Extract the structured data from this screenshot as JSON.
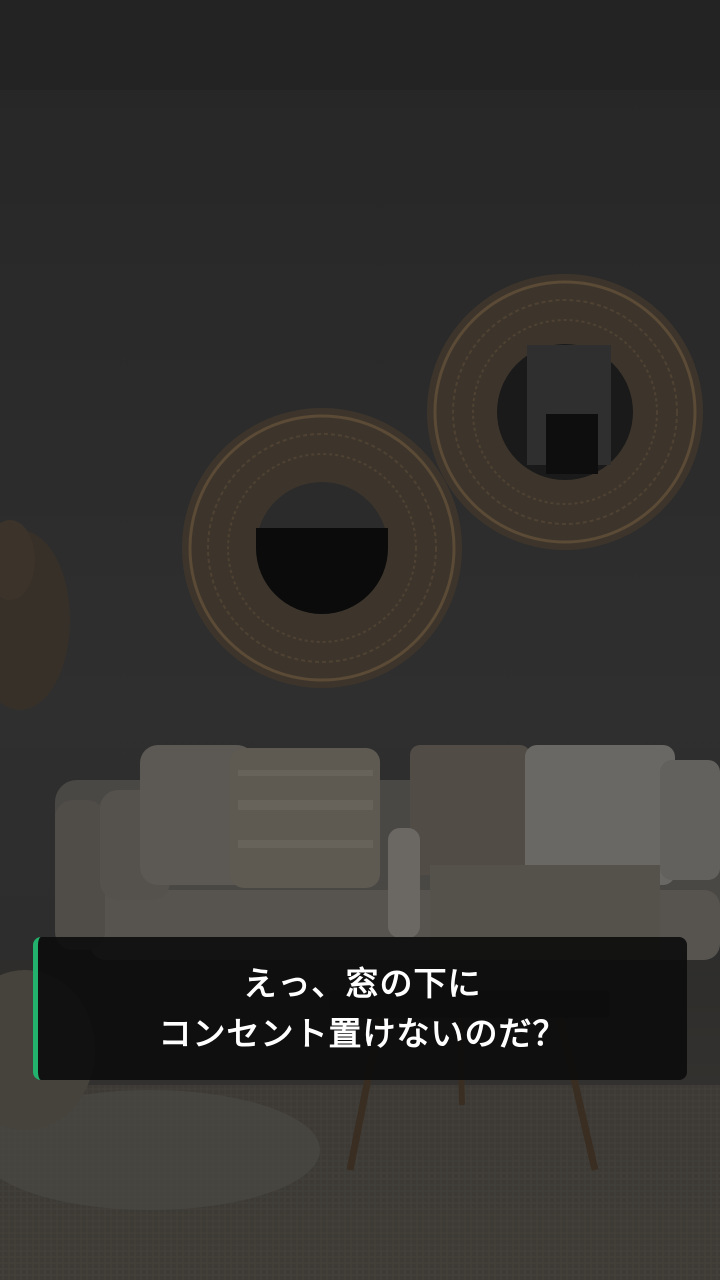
{
  "caption": {
    "line1": "えっ、窓の下に",
    "line2": "コンセント置けないのだ？"
  },
  "colors": {
    "accent": "#23b26d",
    "caption_bg": "#0c0c0c",
    "caption_text": "#ffffff"
  }
}
